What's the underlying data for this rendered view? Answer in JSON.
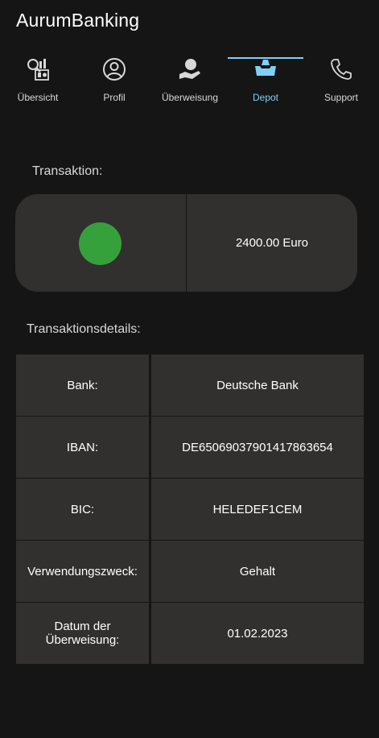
{
  "app": {
    "title": "AurumBanking"
  },
  "tabs": [
    {
      "label": "Übersicht",
      "icon": "overview-icon"
    },
    {
      "label": "Profil",
      "icon": "profile-icon"
    },
    {
      "label": "Überweisung",
      "icon": "transfer-icon"
    },
    {
      "label": "Depot",
      "icon": "depot-icon",
      "active": true
    },
    {
      "label": "Support",
      "icon": "phone-icon"
    }
  ],
  "colors": {
    "accent": "#7fd0f5",
    "status_ok": "#35a13b",
    "card_bg": "#322f2f",
    "page_bg": "#151515"
  },
  "transaction": {
    "heading": "Transaktion:",
    "status": "success",
    "amount": "2400.00 Euro"
  },
  "details": {
    "heading": "Transaktionsdetails:",
    "rows": [
      {
        "key": "Bank:",
        "value": "Deutsche Bank"
      },
      {
        "key": "IBAN:",
        "value": "DE65069037901417863654"
      },
      {
        "key": "BIC:",
        "value": "HELEDEF1CEM"
      },
      {
        "key": "Verwendungszweck:",
        "value": "Gehalt"
      },
      {
        "key": "Datum der Überweisung:",
        "value": "01.02.2023"
      }
    ]
  }
}
